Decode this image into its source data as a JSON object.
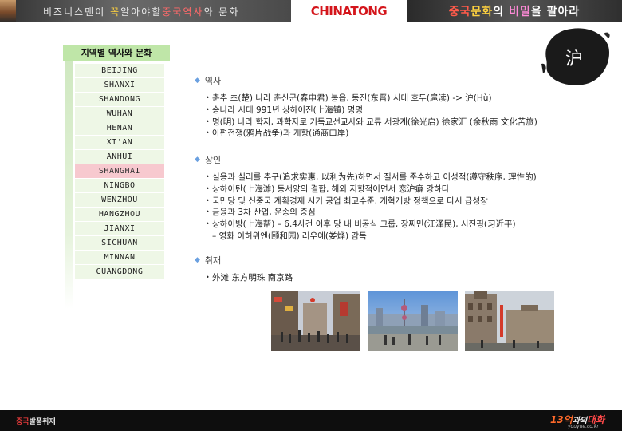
{
  "header": {
    "left_title": {
      "a": "비즈니스맨이 ",
      "b": "꼭",
      "c": "알아야할",
      "d": "중국역사",
      "e": "와 문화"
    },
    "logo_text": "CHINATONG",
    "right_title": {
      "a": "중국",
      "b": "문화",
      "c": "의 ",
      "d": "비밀",
      "e": "을 팔아라"
    }
  },
  "sidebar": {
    "title": "지역별 역사와 문화",
    "cities": [
      "BEIJING",
      "SHANXI",
      "SHANDONG",
      "WUHAN",
      "HENAN",
      "XI'AN",
      "ANHUI",
      "SHANGHAI",
      "NINGBO",
      "WENZHOU",
      "HANGZHOU",
      "JIANXI",
      "SICHUAN",
      "MINNAN",
      "GUANGDONG"
    ],
    "active_index": 7
  },
  "badge": {
    "char": "沪"
  },
  "sections": {
    "history": {
      "heading": "역사",
      "items": [
        "춘추 초(楚) 나라 춘신군(春申君) 봉읍, 동진(东晋) 시대 호두(扈渎) -> 沪(Hù)",
        "송나라 시대 991년 상하이진(上海镇) 명명",
        "명(明) 나라 학자, 과학자로 기독교선교사와 교류 서광계(徐光启) 徐家汇 (余秋雨 文化苦旅)",
        "아편전쟁(鸦片战争)과 개항(通商口岸)"
      ]
    },
    "merchants": {
      "heading": "상인",
      "items": [
        "실용과 실리를 추구(追求实惠, 以利为先)하면서 질서를 준수하고 이성적(遵守秩序, 理性的)",
        "상하이탄(上海滩) 동서양의 결합, 해외 지향적이면서 恋沪癖 강하다",
        "국민당 및 신중국 계획경제 시기 공업 최고수준, 개혁개방 정책으로 다시 급성장",
        "금융과 3차 산업, 운송의 중심",
        "상하이방(上海帮) – 6.4사건 이후 당 내 비공식 그룹, 장쩌민(江泽民), 시진핑(习近平)"
      ],
      "sub_item": "– 영화 이허위엔(颐和园) 러우예(娄烨) 감독"
    },
    "interview": {
      "heading": "취재",
      "items": [
        "外滩 东方明珠 南京路"
      ]
    }
  },
  "photos": [
    {
      "name": "nanjing-road-photo"
    },
    {
      "name": "pudong-skyline-photo"
    },
    {
      "name": "bund-buildings-photo"
    }
  ],
  "footer": {
    "left": {
      "a": "중국",
      "b": "발품취재"
    },
    "right": {
      "a": "13억",
      "b": "과의",
      "c": "대화"
    },
    "sub": "youyue.co.kr"
  },
  "colors": {
    "sidebar_item_bg": "#eef7e6",
    "sidebar_active_bg": "#f7c9cf",
    "logo_red": "#d4151b",
    "section_bullet": "#6aa0e0"
  }
}
